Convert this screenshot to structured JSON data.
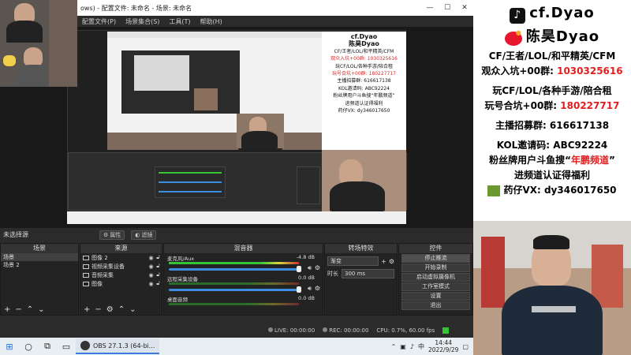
{
  "obs": {
    "titlebar": {
      "title": "ows) - 配置文件: 未命名 - 场景: 未命名",
      "min": "—",
      "max": "☐",
      "close": "✕"
    },
    "menu": [
      "配置文件(P)",
      "场景集合(S)",
      "工具(T)",
      "帮助(H)"
    ],
    "no_source": "未选择源",
    "props_btn": "属性",
    "filters_btn": "滤镜",
    "scenes": {
      "header": "场景",
      "items": [
        "场景",
        "场景 2"
      ]
    },
    "sources": {
      "header": "来源",
      "items": [
        {
          "label": "图像 2",
          "icon": "image-icon"
        },
        {
          "label": "视频采集设备",
          "icon": "camera-icon"
        },
        {
          "label": "音频采集",
          "icon": "monitor-icon"
        },
        {
          "label": "图像",
          "icon": "image-icon"
        }
      ]
    },
    "mixer": {
      "header": "混音器",
      "channels": [
        {
          "name": "麦克风/Aux",
          "db": "-4.8 dB",
          "level": 0.88,
          "volume": 0.99
        },
        {
          "name": "远程采集设备",
          "db": "0.0 dB",
          "level": 0.0,
          "volume": 0.99
        },
        {
          "name": "桌面音频",
          "db": "0.0 dB",
          "level": 0.0,
          "volume": 0.99
        }
      ]
    },
    "transitions": {
      "header": "转场特效",
      "type": "渐变",
      "duration_label": "时长",
      "duration_value": "300 ms"
    },
    "controls": {
      "header": "控件",
      "buttons": [
        "停止推流",
        "开始录制",
        "启动虚拟摄像机",
        "工作室模式",
        "设置",
        "退出"
      ]
    },
    "status": {
      "live": "LIVE: 00:00:00",
      "rec": "REC: 00:00:00",
      "cpu": "CPU: 0.7%, 60.00 fps"
    }
  },
  "taskbar": {
    "app_label": "OBS 27.1.3 (64-bi...",
    "time": "14:44",
    "date": "2022/9/29",
    "lang": "中"
  },
  "banner": {
    "brand1": "cf.Dyao",
    "brand2": "陈昊Dyao",
    "lines": [
      {
        "text": "CF/王者/LOL/和平精英/CFM",
        "red": false
      },
      {
        "text": "观众入坑+00群: ",
        "red": false,
        "tail": "1030325616"
      },
      {
        "text": "玩CF/LOL/各种手游/陪合租",
        "red": false
      },
      {
        "text": "玩号合坑+00群: ",
        "red": false,
        "tail": "180227717"
      },
      {
        "text": "主播招募群: 616617138",
        "red": false
      },
      {
        "text": "KOL邀请码: ABC92224",
        "red": false
      },
      {
        "text": "粉丝牌用户斗鱼搜“",
        "red": false,
        "tail": "年鹏频道",
        "end": "”"
      },
      {
        "text": "进频道认证得福利",
        "red": false
      },
      {
        "text": "药仔VX: dy346017650",
        "red": false
      }
    ]
  },
  "inner_banner": {
    "brand1": "cf.Dyao",
    "brand2": "陈昊Dyao",
    "lines": [
      "CF/王者/LOL/和平精英/CFM",
      "观众入坑+00群: 1030325616",
      "玩CF/LOL/各种手游/陪合租",
      "玩号合坑+00群: 180227717",
      "主播招募群: 616617138",
      "KOL邀请码: ABC92224",
      "粉丝牌用户斗鱼搜“年鹏频道”",
      "进频道认证得福利",
      "药仔VX: dy346017650"
    ]
  },
  "colors": {
    "accent_red": "#e02020",
    "obs_bg": "#2b2b2b",
    "meter_green": "#35c435",
    "slider_blue": "#3c8ee0"
  }
}
